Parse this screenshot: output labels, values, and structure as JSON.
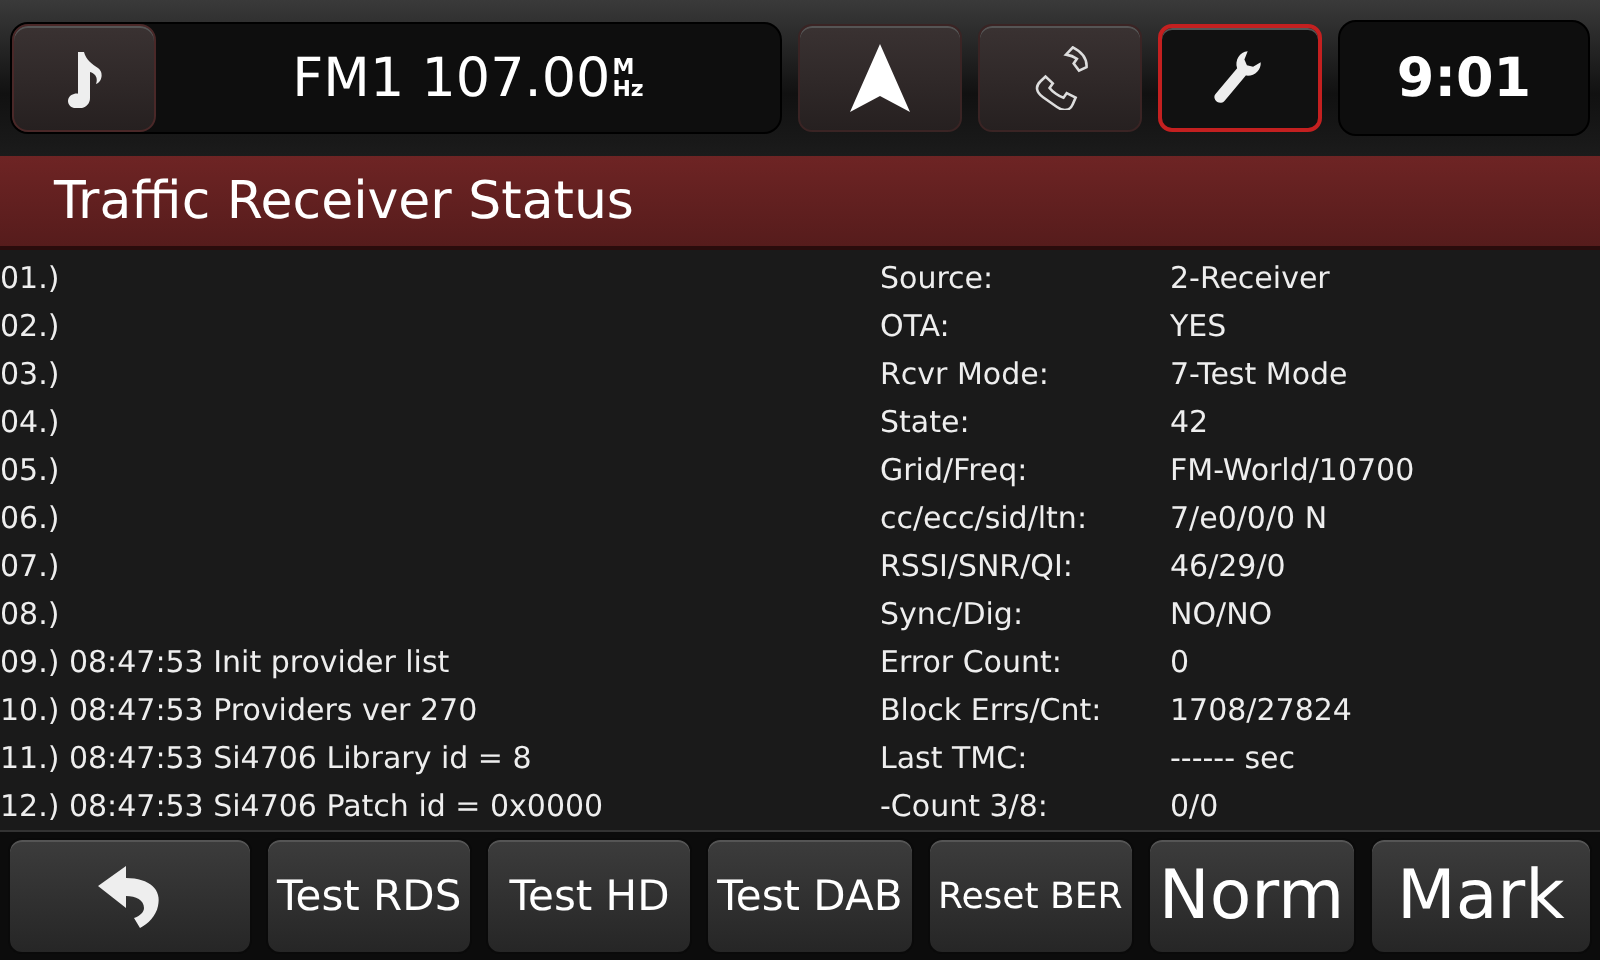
{
  "top_bar": {
    "source": {
      "kind": "music"
    },
    "frequency": "FM1 107.00",
    "unit_top": "M",
    "unit_bottom": "Hz",
    "shortcuts": [
      {
        "kind": "navigation",
        "selected": false
      },
      {
        "kind": "phone",
        "selected": false
      },
      {
        "kind": "settings",
        "selected": true
      }
    ],
    "clock": "9:01"
  },
  "title": "Traffic Receiver Status",
  "log": [
    "01.)",
    "02.)",
    "03.)",
    "04.)",
    "05.)",
    "06.)",
    "07.)",
    "08.)",
    "09.) 08:47:53 Init provider list",
    "10.) 08:47:53 Providers ver 270",
    "11.) 08:47:53 Si4706 Library id = 8",
    "12.) 08:47:53 Si4706 Patch id = 0x0000"
  ],
  "status": [
    {
      "label": "Source:",
      "value": "2-Receiver"
    },
    {
      "label": "OTA:",
      "value": "YES"
    },
    {
      "label": "Rcvr Mode:",
      "value": "7-Test Mode"
    },
    {
      "label": "State:",
      "value": "42"
    },
    {
      "label": "Grid/Freq:",
      "value": "FM-World/10700"
    },
    {
      "label": "cc/ecc/sid/ltn:",
      "value": "7/e0/0/0 N"
    },
    {
      "label": "RSSI/SNR/QI:",
      "value": "46/29/0"
    },
    {
      "label": "Sync/Dig:",
      "value": "NO/NO"
    },
    {
      "label": "Error Count:",
      "value": "0"
    },
    {
      "label": "Block Errs/Cnt:",
      "value": "1708/27824"
    },
    {
      "label": "Last TMC:",
      "value": "------ sec"
    },
    {
      "label": "-Count 3/8:",
      "value": "0/0"
    }
  ],
  "softkeys": [
    {
      "kind": "back"
    },
    {
      "kind": "text",
      "label": "Test RDS"
    },
    {
      "kind": "text",
      "label": "Test HD"
    },
    {
      "kind": "text",
      "label": "Test DAB"
    },
    {
      "kind": "compact",
      "label": "Reset BER"
    },
    {
      "kind": "large",
      "label": "Norm"
    },
    {
      "kind": "large",
      "label": "Mark"
    }
  ]
}
